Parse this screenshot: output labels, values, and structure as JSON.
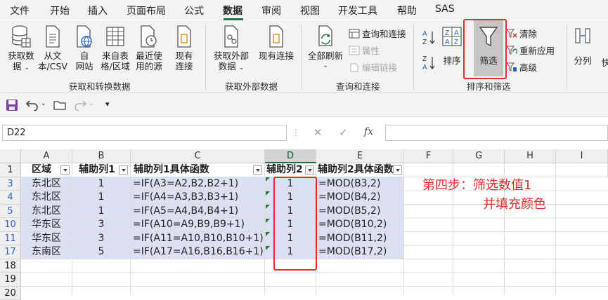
{
  "menu": {
    "items": [
      "文件",
      "开始",
      "插入",
      "页面布局",
      "公式",
      "数据",
      "审阅",
      "视图",
      "开发工具",
      "帮助",
      "SAS"
    ],
    "active": "数据"
  },
  "ribbon": {
    "get_data_label_1": "获取数",
    "get_data_label_2": "据",
    "from_text_1": "从文",
    "from_text_2": "本/CSV",
    "from_web_1": "自",
    "from_web_2": "网站",
    "from_table_1": "来自表",
    "from_table_2": "格/区域",
    "recent_1": "最近使",
    "recent_2": "用的源",
    "existing_1": "现有",
    "existing_2": "连接",
    "group1_label": "获取和转换数据",
    "ext_data_1": "获取外部",
    "ext_data_2": "数据",
    "existing_conn": "现有连接",
    "group2_label": "获取外部数据",
    "refresh_all": "全部刷新",
    "queries_conn": "查询和连接",
    "properties": "属性",
    "edit_links": "编辑链接",
    "group3_label": "查询和连接",
    "sort": "排序",
    "filter": "筛选",
    "clear": "清除",
    "reapply": "重新应用",
    "advanced": "高级",
    "group4_label": "排序和筛选",
    "split": "分列",
    "flash": "快"
  },
  "formula_bar": {
    "name_box": "D22",
    "formula": ""
  },
  "columns": [
    "A",
    "B",
    "C",
    "D",
    "E",
    "F",
    "G",
    "H",
    "I"
  ],
  "header_row": {
    "row": "1",
    "a": "区域",
    "b": "辅助列1",
    "c": "辅助列1具体函数",
    "d": "辅助列2",
    "e": "辅助列2具体函数"
  },
  "rows": [
    {
      "row": "3",
      "a": "东北区",
      "b": "1",
      "c": "=IF(A3=A2,B2,B2+1)",
      "d": "1",
      "e": "=MOD(B3,2)"
    },
    {
      "row": "4",
      "a": "东北区",
      "b": "1",
      "c": "=IF(A4=A3,B3,B3+1)",
      "d": "1",
      "e": "=MOD(B4,2)"
    },
    {
      "row": "5",
      "a": "东北区",
      "b": "1",
      "c": "=IF(A5=A4,B4,B4+1)",
      "d": "1",
      "e": "=MOD(B5,2)"
    },
    {
      "row": "10",
      "a": "华东区",
      "b": "3",
      "c": "=IF(A10=A9,B9,B9+1)",
      "d": "1",
      "e": "=MOD(B10,2)"
    },
    {
      "row": "11",
      "a": "华东区",
      "b": "3",
      "c": "=IF(A11=A10,B10,B10+1)",
      "d": "1",
      "e": "=MOD(B11,2)"
    },
    {
      "row": "17",
      "a": "东南区",
      "b": "5",
      "c": "=IF(A17=A16,B16,B16+1)",
      "d": "1",
      "e": "=MOD(B17,2)"
    }
  ],
  "empty_rows": [
    "18",
    "19",
    "20"
  ],
  "annotation": {
    "line1": "第四步：筛选数值1",
    "line2": "并填充颜色"
  },
  "colors": {
    "highlight": "#dbe0f2",
    "accent": "#217346",
    "annotation": "#e82a2a"
  }
}
